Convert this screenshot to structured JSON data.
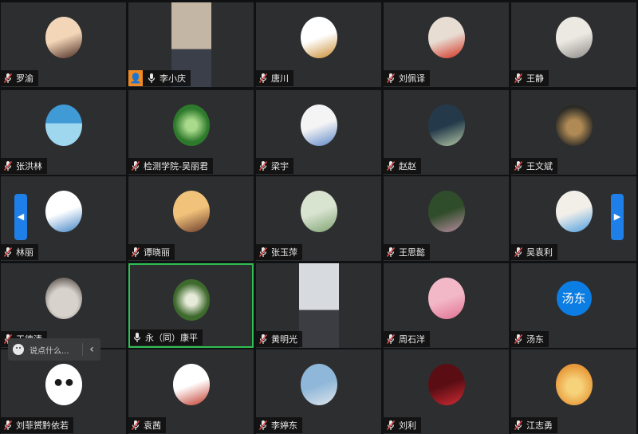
{
  "tiles": [
    {
      "name": "罗渝",
      "icon": "mic-muted",
      "avatar": "cartoon-girl",
      "colors": [
        "#f3d6b8",
        "#4a2a22"
      ]
    },
    {
      "name": "李小庆",
      "icon": "mic-on",
      "host": true,
      "avatar": "video",
      "colors": [
        "#c4b6a4",
        "#3a3f4a"
      ]
    },
    {
      "name": "唐川",
      "icon": "mic-muted",
      "avatar": "monkey-king",
      "colors": [
        "#ffffff",
        "#c98a2e"
      ]
    },
    {
      "name": "刘佩译",
      "icon": "mic-muted",
      "avatar": "clown",
      "colors": [
        "#e8ddd3",
        "#d32f1e"
      ]
    },
    {
      "name": "王静",
      "icon": "mic-muted",
      "avatar": "street",
      "colors": [
        "#ece8e2",
        "#8d8a86"
      ]
    },
    {
      "name": "张洪林",
      "icon": "mic-muted",
      "avatar": "sea",
      "colors": [
        "#3f9ad6",
        "#9fd7ef"
      ]
    },
    {
      "name": "检测学院-吴丽君",
      "icon": "mic-muted",
      "avatar": "clover",
      "colors": [
        "#2e7a2c",
        "#a9d98a"
      ]
    },
    {
      "name": "梁宇",
      "icon": "mic-muted",
      "avatar": "stitch",
      "colors": [
        "#f4f4f4",
        "#5b86c8"
      ]
    },
    {
      "name": "赵赵",
      "icon": "mic-muted",
      "avatar": "arrow-art",
      "colors": [
        "#243a4a",
        "#b5c9a6"
      ]
    },
    {
      "name": "王文斌",
      "icon": "mic-muted",
      "avatar": "sunset",
      "colors": [
        "#2a2a25",
        "#b08a55"
      ]
    },
    {
      "name": "林丽",
      "icon": "mic-muted",
      "avatar": "anime-boy",
      "colors": [
        "#ffffff",
        "#3e82c4"
      ]
    },
    {
      "name": "谭晓丽",
      "icon": "mic-muted",
      "avatar": "portrait",
      "colors": [
        "#f0c27a",
        "#6a3a2a"
      ]
    },
    {
      "name": "张玉萍",
      "icon": "mic-muted",
      "avatar": "bamboo",
      "colors": [
        "#d8e3d0",
        "#7fa372"
      ]
    },
    {
      "name": "王思懿",
      "icon": "mic-muted",
      "avatar": "garden",
      "colors": [
        "#2f4d2a",
        "#b88ca0"
      ]
    },
    {
      "name": "吴袁利",
      "icon": "mic-muted",
      "avatar": "pinwheel",
      "colors": [
        "#f2efe9",
        "#4a9de0"
      ]
    },
    {
      "name": "王德清",
      "icon": "mic-muted",
      "avatar": "cat",
      "colors": [
        "#d8d2cc",
        "#6c6460"
      ]
    },
    {
      "name": "永（同）康平",
      "icon": "mic-on",
      "active": true,
      "avatar": "lotus",
      "colors": [
        "#3f6a2e",
        "#e6ead8"
      ]
    },
    {
      "name": "黄明光",
      "icon": "mic-muted",
      "avatar": "video",
      "colors": [
        "#d7dbe0",
        "#3b3d42"
      ]
    },
    {
      "name": "周石洋",
      "icon": "mic-muted",
      "avatar": "pink-kids",
      "colors": [
        "#f3b8c8",
        "#e07090"
      ]
    },
    {
      "name": "汤东",
      "icon": "mic-muted",
      "avatar": "text",
      "avatar_text": "汤东",
      "colors": [
        "#0b7de3",
        "#ffffff"
      ]
    },
    {
      "name": "刘菲赟黔依若",
      "icon": "mic-muted",
      "avatar": "panda",
      "colors": [
        "#ffffff",
        "#1a1a1a"
      ]
    },
    {
      "name": "袁茜",
      "icon": "mic-muted",
      "avatar": "cartoon-kid",
      "colors": [
        "#ffffff",
        "#c0392b"
      ]
    },
    {
      "name": "李婷东",
      "icon": "mic-muted",
      "avatar": "building",
      "colors": [
        "#8fb7d9",
        "#dfe6ec"
      ]
    },
    {
      "name": "刘利",
      "icon": "mic-muted",
      "avatar": "dancer",
      "colors": [
        "#5a0e14",
        "#d22a33"
      ]
    },
    {
      "name": "江志勇",
      "icon": "mic-muted",
      "avatar": "sunset-couple",
      "colors": [
        "#e89a3a",
        "#f6d27a"
      ]
    }
  ],
  "chat": {
    "placeholder": "说点什么...",
    "emoji_icon": "emoji-icon",
    "collapse_icon": "chevron-left-icon"
  },
  "nav": {
    "left_icon": "arrow-left-icon",
    "right_icon": "arrow-right-icon"
  }
}
